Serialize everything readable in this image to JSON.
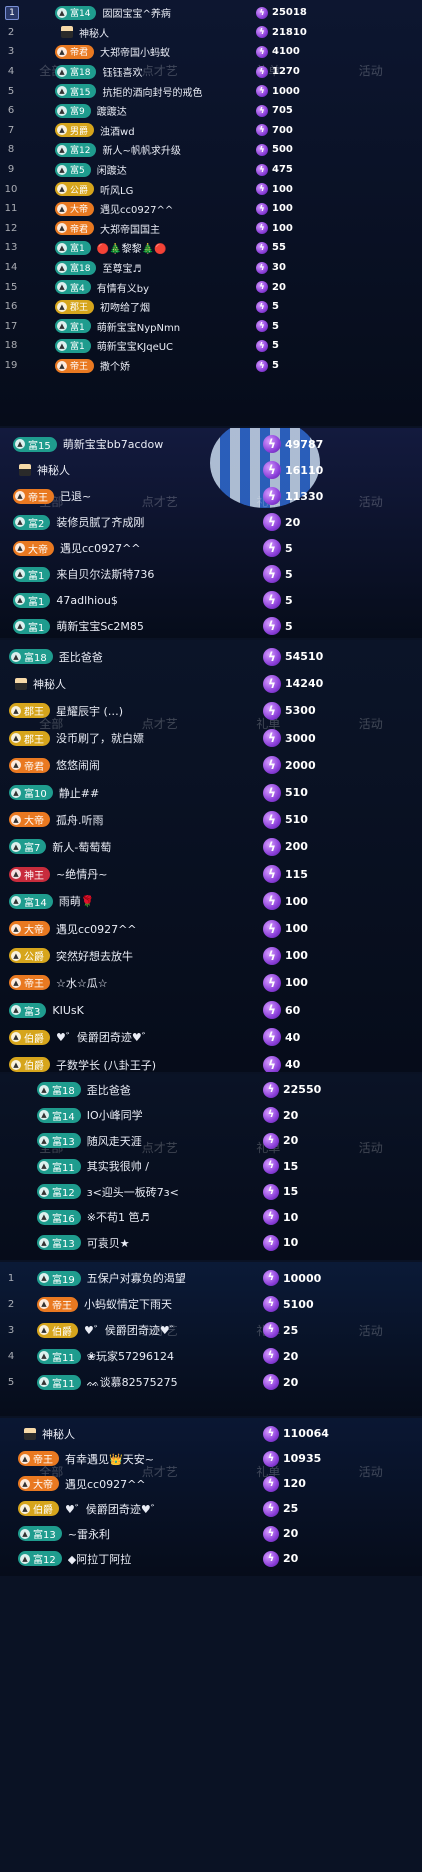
{
  "panels": [
    {
      "id": "p1",
      "background_tabs": [
        "全部",
        "点才艺",
        "礼单",
        "活动"
      ],
      "rows": [
        {
          "rank": "1",
          "badge": "富14",
          "badge_color": "teal",
          "name": "囡囡宝宝^养病",
          "value": "25018",
          "top": true
        },
        {
          "rank": "2",
          "badge": "",
          "badge_color": "none",
          "name": "神秘人",
          "value": "21810",
          "mystery": true
        },
        {
          "rank": "3",
          "badge": "帝君",
          "badge_color": "orange",
          "name": "大郑帝国小蚂蚁",
          "value": "4100"
        },
        {
          "rank": "4",
          "badge": "富18",
          "badge_color": "teal",
          "name": "钰钰喜欢",
          "value": "1270"
        },
        {
          "rank": "5",
          "badge": "富15",
          "badge_color": "teal",
          "name": "抗拒的酒向封号的戒色",
          "value": "1000"
        },
        {
          "rank": "6",
          "badge": "富9",
          "badge_color": "teal",
          "name": "踱踱达",
          "value": "705"
        },
        {
          "rank": "7",
          "badge": "男爵",
          "badge_color": "gold",
          "name": "浊酒wd",
          "value": "700"
        },
        {
          "rank": "8",
          "badge": "富12",
          "badge_color": "teal",
          "name": "新人~帆帆求升级",
          "value": "500"
        },
        {
          "rank": "9",
          "badge": "富5",
          "badge_color": "teal",
          "name": "闲踱达",
          "value": "475"
        },
        {
          "rank": "10",
          "badge": "公爵",
          "badge_color": "gold",
          "name": "听风LG",
          "value": "100"
        },
        {
          "rank": "11",
          "badge": "大帝",
          "badge_color": "orange",
          "name": "遇见cc0927^^",
          "value": "100"
        },
        {
          "rank": "12",
          "badge": "帝君",
          "badge_color": "orange",
          "name": "大郑帝国国主",
          "value": "100"
        },
        {
          "rank": "13",
          "badge": "富1",
          "badge_color": "teal",
          "name": "🔴🎄黎黎🎄🔴",
          "value": "55"
        },
        {
          "rank": "14",
          "badge": "富18",
          "badge_color": "teal",
          "name": "至尊宝♬",
          "value": "30"
        },
        {
          "rank": "15",
          "badge": "富4",
          "badge_color": "teal",
          "name": "有情有义by",
          "value": "20"
        },
        {
          "rank": "16",
          "badge": "郡王",
          "badge_color": "gold",
          "name": "初吻给了烟",
          "value": "5"
        },
        {
          "rank": "17",
          "badge": "富1",
          "badge_color": "teal",
          "name": "萌新宝宝NypNmn",
          "value": "5"
        },
        {
          "rank": "18",
          "badge": "富1",
          "badge_color": "teal",
          "name": "萌新宝宝KJqeUC",
          "value": "5"
        },
        {
          "rank": "19",
          "badge": "帝王",
          "badge_color": "orange",
          "name": "撒个娇",
          "value": "5"
        }
      ]
    },
    {
      "id": "p2",
      "background_tabs": [
        "全部",
        "点才艺",
        "礼单",
        "活动"
      ],
      "rows": [
        {
          "rank": "",
          "badge": "富15",
          "badge_color": "teal",
          "name": "萌新宝宝bb7acdow",
          "value": "49787"
        },
        {
          "rank": "",
          "badge": "",
          "badge_color": "none",
          "name": "神秘人",
          "value": "16110",
          "mystery": true
        },
        {
          "rank": "",
          "badge": "帝王",
          "badge_color": "orange",
          "name": "已退~",
          "value": "11330"
        },
        {
          "rank": "",
          "badge": "富2",
          "badge_color": "teal",
          "name": "装修员腻了齐成刚",
          "value": "20"
        },
        {
          "rank": "",
          "badge": "大帝",
          "badge_color": "orange",
          "name": "遇见cc0927^^",
          "value": "5"
        },
        {
          "rank": "",
          "badge": "富1",
          "badge_color": "teal",
          "name": "来自贝尔法斯特736",
          "value": "5"
        },
        {
          "rank": "",
          "badge": "富1",
          "badge_color": "teal",
          "name": "47adlhiou$",
          "value": "5"
        },
        {
          "rank": "",
          "badge": "富1",
          "badge_color": "teal",
          "name": "萌新宝宝Sc2M85",
          "value": "5"
        }
      ]
    },
    {
      "id": "p3",
      "background_tabs": [
        "全部",
        "点才艺",
        "礼单",
        "活动"
      ],
      "rows": [
        {
          "rank": "",
          "badge": "富18",
          "badge_color": "teal",
          "name": "歪比爸爸",
          "value": "54510"
        },
        {
          "rank": "",
          "badge": "",
          "badge_color": "none",
          "name": "神秘人",
          "value": "14240",
          "mystery": true
        },
        {
          "rank": "",
          "badge": "郡王",
          "badge_color": "gold",
          "name": "星耀辰宇 (…)",
          "value": "5300"
        },
        {
          "rank": "",
          "badge": "郡王",
          "badge_color": "gold",
          "name": "没币刷了，就白嫖",
          "value": "3000"
        },
        {
          "rank": "",
          "badge": "帝君",
          "badge_color": "orange",
          "name": "悠悠闹闹",
          "value": "2000"
        },
        {
          "rank": "",
          "badge": "富10",
          "badge_color": "teal",
          "name": "静止##",
          "value": "510"
        },
        {
          "rank": "",
          "badge": "大帝",
          "badge_color": "orange",
          "name": "孤舟.听雨",
          "value": "510"
        },
        {
          "rank": "",
          "badge": "富7",
          "badge_color": "teal",
          "name": "新人-萄萄萄",
          "value": "200"
        },
        {
          "rank": "",
          "badge": "神王",
          "badge_color": "red",
          "name": "~绝情丹~",
          "value": "115"
        },
        {
          "rank": "",
          "badge": "富14",
          "badge_color": "teal",
          "name": "雨萌🌹",
          "value": "100"
        },
        {
          "rank": "",
          "badge": "大帝",
          "badge_color": "orange",
          "name": "遇见cc0927^^",
          "value": "100"
        },
        {
          "rank": "",
          "badge": "公爵",
          "badge_color": "gold",
          "name": "突然好想去放牛",
          "value": "100"
        },
        {
          "rank": "",
          "badge": "帝王",
          "badge_color": "orange",
          "name": "☆水☆瓜☆",
          "value": "100"
        },
        {
          "rank": "",
          "badge": "富3",
          "badge_color": "teal",
          "name": "KIUsK",
          "value": "60"
        },
        {
          "rank": "",
          "badge": "伯爵",
          "badge_color": "gold",
          "name": "♥゛侯爵团奇迹♥゛",
          "value": "40"
        },
        {
          "rank": "",
          "badge": "伯爵",
          "badge_color": "gold",
          "name": "子数学长 (八卦王子)",
          "value": "40"
        }
      ]
    },
    {
      "id": "p4",
      "background_tabs": [
        "全部",
        "点才艺",
        "礼单",
        "活动"
      ],
      "rows": [
        {
          "rank": "",
          "badge": "富18",
          "badge_color": "teal",
          "name": "歪比爸爸",
          "value": "22550"
        },
        {
          "rank": "",
          "badge": "富14",
          "badge_color": "teal",
          "name": "IO小峰同学",
          "value": "20"
        },
        {
          "rank": "",
          "badge": "富13",
          "badge_color": "teal",
          "name": "随风走天涯",
          "value": "20"
        },
        {
          "rank": "",
          "badge": "富11",
          "badge_color": "teal",
          "name": "其实我很帅 /",
          "value": "15"
        },
        {
          "rank": "",
          "badge": "富12",
          "badge_color": "teal",
          "name": "ɜ<迎头一板砖7ɜ<",
          "value": "15"
        },
        {
          "rank": "",
          "badge": "富16",
          "badge_color": "teal",
          "name": "※不苟1 笆♬",
          "value": "10"
        },
        {
          "rank": "",
          "badge": "富13",
          "badge_color": "teal",
          "name": "可袁贝★",
          "value": "10"
        }
      ]
    },
    {
      "id": "p5",
      "background_tabs": [
        "全部",
        "点才艺",
        "礼单",
        "活动"
      ],
      "rows": [
        {
          "rank": "1",
          "badge": "富19",
          "badge_color": "teal",
          "name": "五保户对寡负的渴望",
          "value": "10000"
        },
        {
          "rank": "2",
          "badge": "帝王",
          "badge_color": "orange",
          "name": "小蚂蚁情定下雨天",
          "value": "5100"
        },
        {
          "rank": "3",
          "badge": "伯爵",
          "badge_color": "gold",
          "name": "♥゛侯爵团奇迹♥゛",
          "value": "25"
        },
        {
          "rank": "4",
          "badge": "富11",
          "badge_color": "teal",
          "name": "❀玩家57296124",
          "value": "20"
        },
        {
          "rank": "5",
          "badge": "富11",
          "badge_color": "teal",
          "name": "ᨐ谈慕82575275",
          "value": "20"
        }
      ]
    },
    {
      "id": "p6",
      "background_tabs": [
        "全部",
        "点才艺",
        "礼单",
        "活动"
      ],
      "rows": [
        {
          "rank": "",
          "badge": "",
          "badge_color": "none",
          "name": "神秘人",
          "value": "110064",
          "mystery": true
        },
        {
          "rank": "",
          "badge": "帝王",
          "badge_color": "orange",
          "name": "有幸遇见👑天安~",
          "value": "10935"
        },
        {
          "rank": "",
          "badge": "大帝",
          "badge_color": "orange",
          "name": "遇见cc0927^^",
          "value": "120"
        },
        {
          "rank": "",
          "badge": "伯爵",
          "badge_color": "gold",
          "name": "♥゛侯爵团奇迹♥゛",
          "value": "25"
        },
        {
          "rank": "",
          "badge": "富13",
          "badge_color": "teal",
          "name": "~雷永利",
          "value": "20"
        },
        {
          "rank": "",
          "badge": "富12",
          "badge_color": "teal",
          "name": "◆阿拉丁阿拉",
          "value": "20"
        }
      ]
    }
  ],
  "colors": {
    "teal": "#1f9c8e",
    "orange": "#e97921",
    "gold": "#d6a51c",
    "red": "#c82c3c",
    "coin": "#a35ff0"
  }
}
